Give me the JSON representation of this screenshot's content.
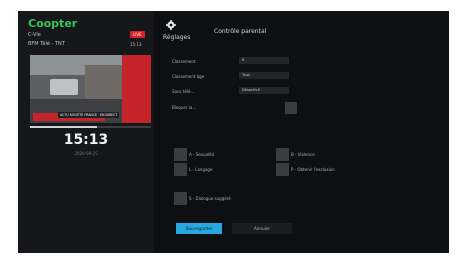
{
  "left_panel": {
    "brand": "Coopter",
    "channel_name": "C-Vie",
    "channel_info": "BFM Télé - TNT",
    "live_badge": "LIVE",
    "channel_time": "15:13",
    "news_text": "ACTU SOCIÉTÉ FRANCE · EN DIRECT",
    "progress": 0.55,
    "clock": "15:13",
    "date": "2020-08-25"
  },
  "settings": {
    "title": "Réglages",
    "section": "Contrôle parental",
    "rows": [
      {
        "label": "Classement",
        "value": "8"
      },
      {
        "label": "Classement âge",
        "value": "Tous"
      },
      {
        "label": "Sans télé...",
        "value": "Désactivé"
      }
    ],
    "blocked_label": "Bloquer la...",
    "options": [
      {
        "label": "A - Sexualité"
      },
      {
        "label": "B - Violence"
      },
      {
        "label": "L - Langage"
      },
      {
        "label": "P - Obtenir l'exclusion"
      },
      {
        "label": "S - Dialogue suggéré"
      }
    ]
  },
  "buttons": {
    "primary": "Sauvegarder",
    "secondary": "Annuler"
  },
  "colors": {
    "brand": "#34c759",
    "accent": "#27a8e0",
    "live": "#d81f26"
  },
  "icons": {
    "settings": "gear-icon"
  }
}
